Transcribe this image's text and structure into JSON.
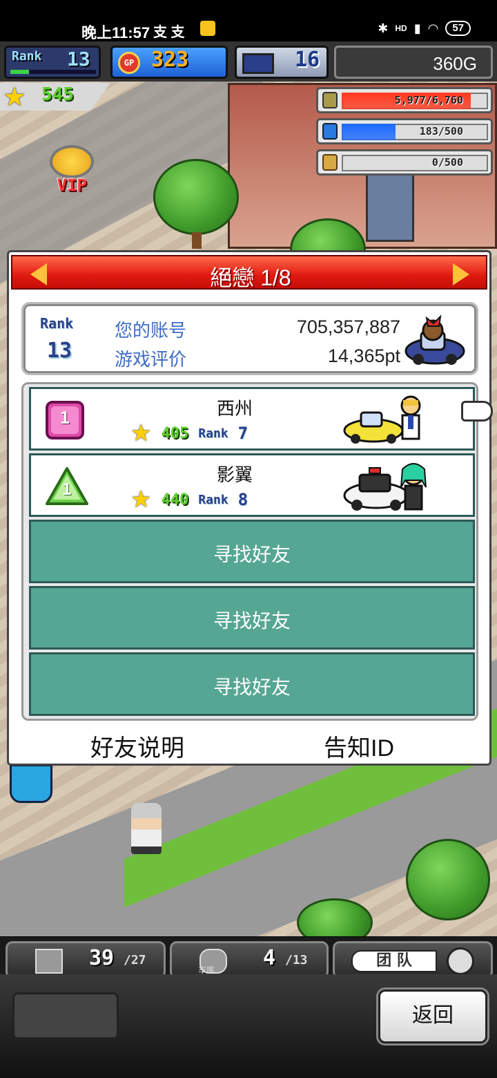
{
  "status_bar": {
    "time": "晚上11:57",
    "notif_glyphs": "支 支",
    "signal_label": "HD",
    "battery": "57"
  },
  "hud": {
    "rank_label": "Rank",
    "rank_value": "13",
    "rank_progress": 0.22,
    "gp_label": "GP",
    "gp_value": "323",
    "pc_value": "16",
    "money": "360G"
  },
  "star_score": "545",
  "resources": [
    {
      "icon": "coin-stack-icon",
      "text": "5,977/6,760",
      "color": "#ff3a20",
      "fraction": 0.88
    },
    {
      "icon": "fuel-can-icon",
      "text": "183/500",
      "color": "#1e6bff",
      "fraction": 0.366
    },
    {
      "icon": "wheat-icon",
      "text": "0/500",
      "color": "#cfa24a",
      "fraction": 0
    }
  ],
  "vip_label": "VIP",
  "dialog": {
    "title": "絕戀 1/8",
    "my_rank_label": "Rank",
    "my_rank_value": "13",
    "account_label": "您的账号",
    "account_value": "705,357,887",
    "rating_label": "游戏评价",
    "rating_value": "14,365pt",
    "friends": [
      {
        "badge": "1",
        "name": "西州",
        "stars": "405",
        "rank_label": "Rank",
        "rank": "7"
      },
      {
        "badge": "1",
        "name": "影翼",
        "stars": "440",
        "rank_label": "Rank",
        "rank": "8"
      }
    ],
    "find_friend_label": "寻找好友",
    "friend_help_label": "好友说明",
    "notify_id_label": "告知ID"
  },
  "bottom": {
    "tab1_count": "39",
    "tab1_total": "/27",
    "tab2_count": "4",
    "tab2_total": "/13",
    "garage_label": "车库",
    "team_label": "团 队",
    "back_label": "返回"
  },
  "colors": {
    "title_bar": "#e01a10",
    "find_row": "#56a694",
    "accent_blue": "#3f6cc6"
  }
}
